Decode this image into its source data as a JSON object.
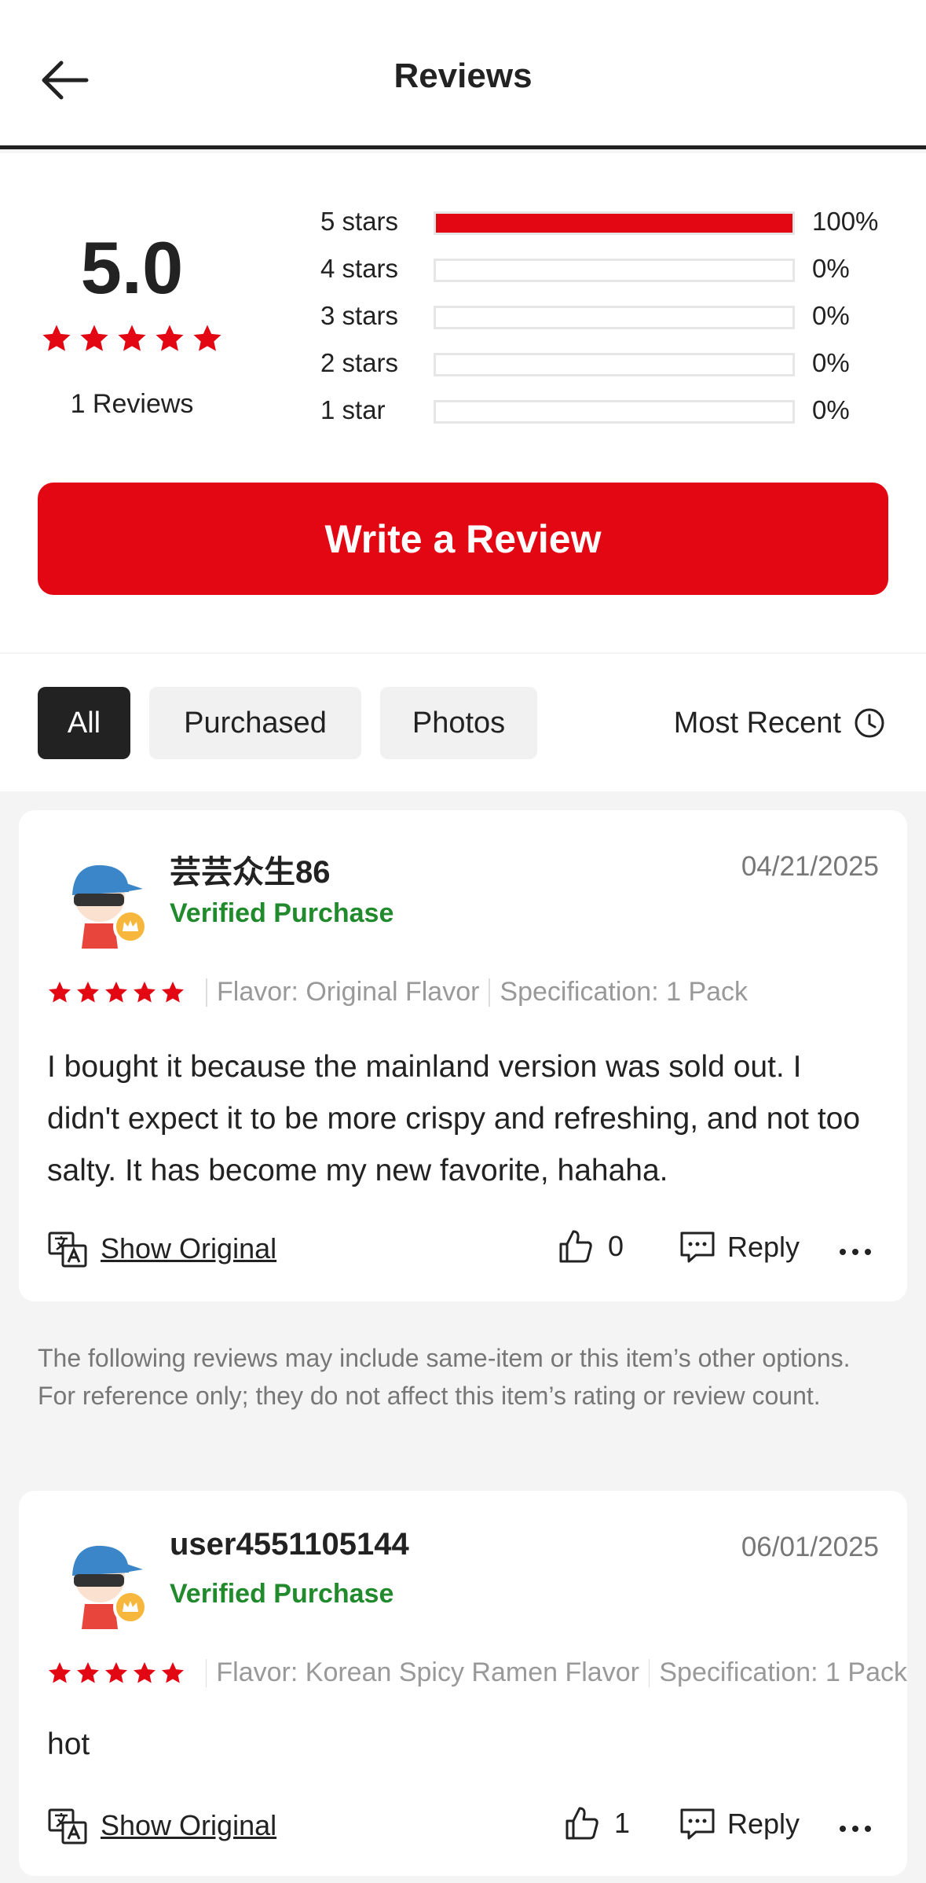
{
  "header": {
    "title": "Reviews",
    "back_icon": "arrow-left-icon"
  },
  "summary": {
    "rating": "5.0",
    "stars": 5,
    "reviews_count": "1 Reviews",
    "distribution": [
      {
        "label": "5 stars",
        "pct": "100%",
        "fraction": 1.0
      },
      {
        "label": "4 stars",
        "pct": "0%",
        "fraction": 0
      },
      {
        "label": "3 stars",
        "pct": "0%",
        "fraction": 0
      },
      {
        "label": "2 stars",
        "pct": "0%",
        "fraction": 0
      },
      {
        "label": "1 star",
        "pct": "0%",
        "fraction": 0
      }
    ],
    "write_review_label": "Write a Review"
  },
  "filters": {
    "all": "All",
    "purchased": "Purchased",
    "photos": "Photos",
    "sort_label": "Most Recent",
    "sort_icon": "clock-icon"
  },
  "reviews": [
    {
      "username": "芸芸众生86",
      "date": "04/21/2025",
      "verified": "Verified Purchase",
      "rating": 5,
      "flavor": "Flavor: Original Flavor",
      "specification": "Specification: 1 Pack",
      "text": "I bought it because the mainland version was sold out. I didn't expect it to be more crispy and refreshing, and not too salty. It has become my new favorite, hahaha.",
      "show_original": "Show Original",
      "likes": "0",
      "reply_label": "Reply"
    },
    {
      "username": "user4551105144",
      "date": "06/01/2025",
      "verified": "Verified Purchase",
      "rating": 5,
      "flavor": "Flavor: Korean Spicy Ramen Flavor",
      "specification": "Specification: 1 Pack",
      "text": "hot",
      "show_original": "Show Original",
      "likes": "1",
      "reply_label": "Reply"
    }
  ],
  "note": "The following reviews may include same-item or this item’s other options. For reference only; they do not affect this item’s rating or review count.",
  "colors": {
    "accent": "#e30613",
    "verified": "#218a2c"
  }
}
